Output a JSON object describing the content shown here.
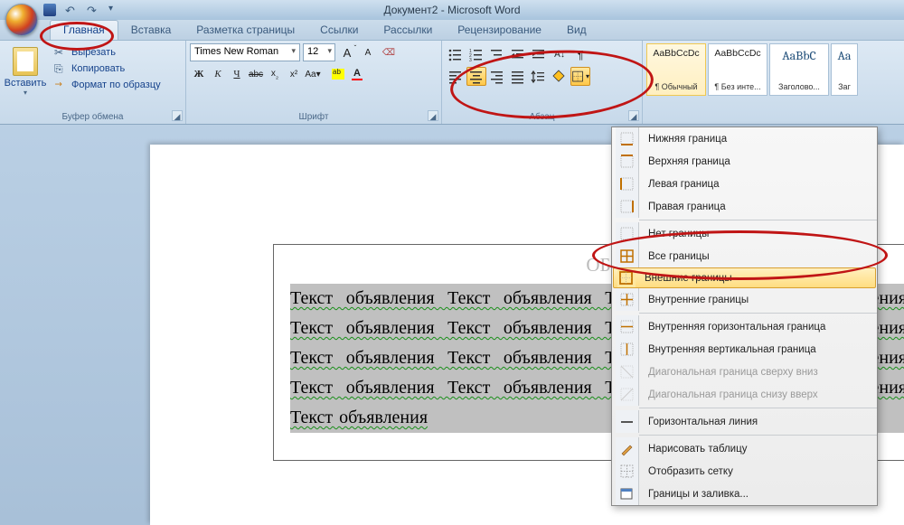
{
  "title": "Документ2 - Microsoft Word",
  "tabs": {
    "home": "Главная",
    "insert": "Вставка",
    "layout": "Разметка страницы",
    "references": "Ссылки",
    "mailings": "Рассылки",
    "review": "Рецензирование",
    "view": "Вид"
  },
  "clipboard": {
    "paste": "Вставить",
    "cut": "Вырезать",
    "copy": "Копировать",
    "format": "Формат по образцу",
    "group": "Буфер обмена"
  },
  "font": {
    "name": "Times New Roman",
    "size": "12",
    "group": "Шрифт",
    "bold": "Ж",
    "italic": "К",
    "underline": "Ч",
    "strike": "abc",
    "xsub": "x₂",
    "xsup": "x²",
    "case": "Aa",
    "grow": "A",
    "shrink": "A",
    "clear": "⌫",
    "a_color": "A"
  },
  "para": {
    "group": "Абзац"
  },
  "styles": {
    "preview": "AaBbCcDc",
    "preview_h": "AaBbC",
    "normal": "¶ Обычный",
    "nospacing": "¶ Без инте...",
    "heading1": "Заголово...",
    "heading2": "Заг"
  },
  "border_menu": {
    "bottom": "Нижняя граница",
    "top": "Верхняя граница",
    "left": "Левая граница",
    "right": "Правая граница",
    "none": "Нет границы",
    "all": "Все границы",
    "outside": "Внешние границы",
    "inside": "Внутренние границы",
    "inside_h": "Внутренняя горизонтальная граница",
    "inside_v": "Внутренняя вертикальная граница",
    "diag_down": "Диагональная граница сверху вниз",
    "diag_up": "Диагональная граница снизу вверх",
    "hline": "Горизонтальная линия",
    "draw": "Нарисовать таблицу",
    "grid": "Отобразить сетку",
    "dialog": "Границы и заливка..."
  },
  "doc": {
    "title_behind": "ОБ",
    "body": "Текст объявления  Текст объявления  Текст объявления  Текст объявления  Текст объявления  Текст объявления  Текст объявления  Текст объявления  Текст объявления  Текст объявления  Текст объявления  Текст объявления  Текст объявления  Текст объявления  Текст объявления  Текст объявления  Текст объявления"
  }
}
